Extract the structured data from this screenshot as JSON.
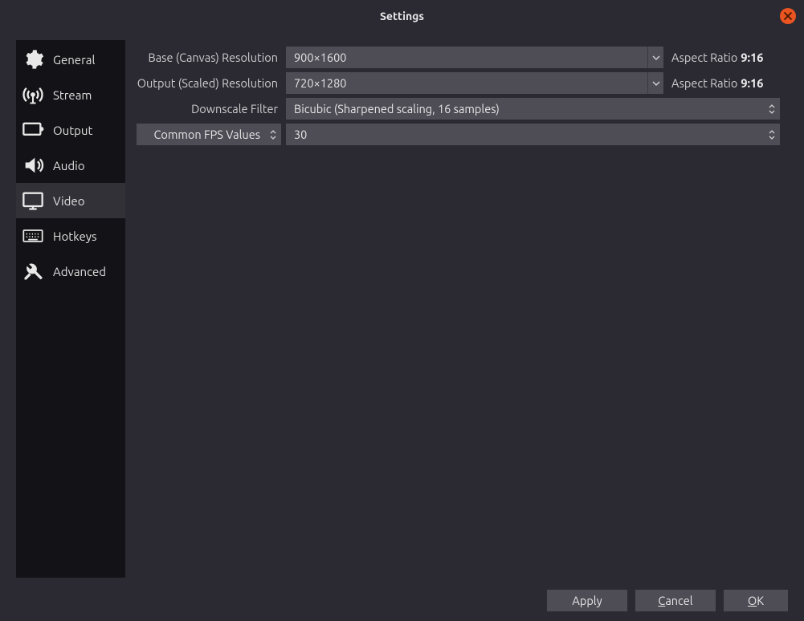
{
  "window": {
    "title": "Settings"
  },
  "sidebar": {
    "items": [
      {
        "label": "General"
      },
      {
        "label": "Stream"
      },
      {
        "label": "Output"
      },
      {
        "label": "Audio"
      },
      {
        "label": "Video"
      },
      {
        "label": "Hotkeys"
      },
      {
        "label": "Advanced"
      }
    ],
    "active_index": 4
  },
  "video": {
    "base_label": "Base (Canvas) Resolution",
    "base_value": "900×1600",
    "base_aspect_label": "Aspect Ratio",
    "base_aspect_value": "9:16",
    "output_label": "Output (Scaled) Resolution",
    "output_value": "720×1280",
    "output_aspect_label": "Aspect Ratio",
    "output_aspect_value": "9:16",
    "downscale_label": "Downscale Filter",
    "downscale_value": "Bicubic (Sharpened scaling, 16 samples)",
    "fps_mode_label": "Common FPS Values",
    "fps_value": "30"
  },
  "buttons": {
    "apply": "Apply",
    "cancel_prefix": "C",
    "cancel_rest": "ancel",
    "ok_prefix": "O",
    "ok_rest": "K"
  }
}
